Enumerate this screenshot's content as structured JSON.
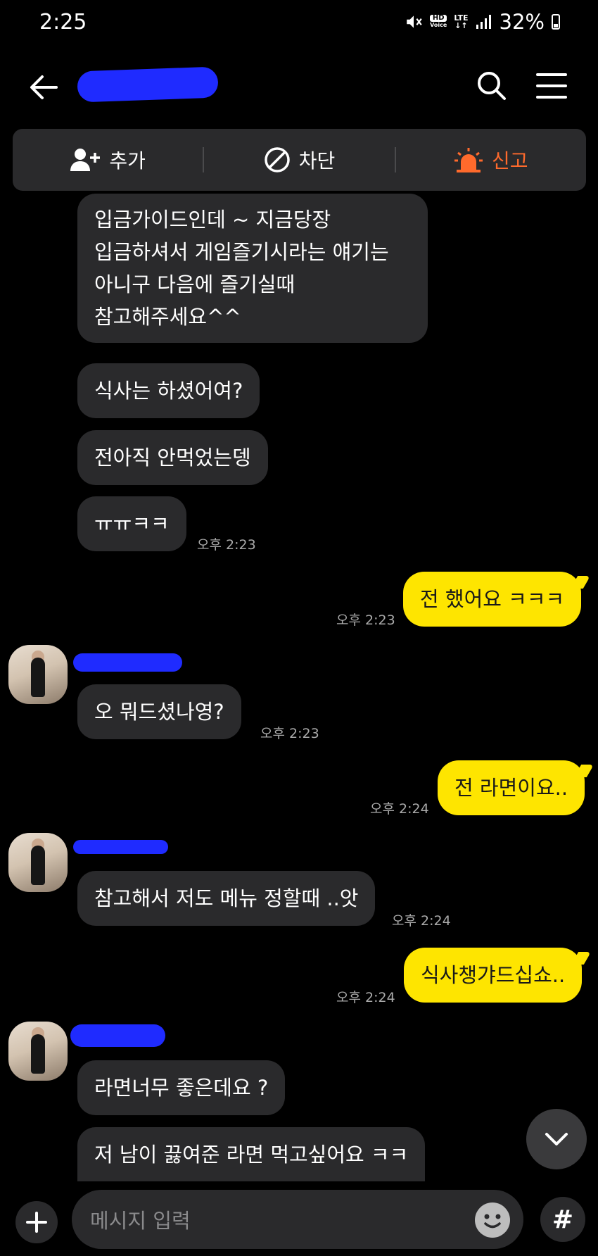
{
  "status_bar": {
    "time": "2:25",
    "hd_label": "HD",
    "voice_label": "Voice",
    "lte_label": "LTE",
    "battery": "32%"
  },
  "toolbar": {
    "add_label": "추가",
    "block_label": "차단",
    "report_label": "신고",
    "report_color": "#ff6a2c"
  },
  "colors": {
    "my_bubble": "#fee500",
    "their_bubble": "#2a2a2c",
    "redaction": "#1f2bff"
  },
  "messages": [
    {
      "sender": "other",
      "text_lines": [
        "입금가이드인데 ~ 지금당장",
        "입금하셔서 게임즐기시라는 얘기는",
        "아니구 다음에 즐기실때",
        "참고해주세요^^"
      ]
    },
    {
      "sender": "other",
      "text": "식사는 하셨어여?"
    },
    {
      "sender": "other",
      "text": "전아직 안먹었는뎅"
    },
    {
      "sender": "other",
      "text": "ㅠㅠㅋㅋ",
      "time": "오후 2:23"
    },
    {
      "sender": "me",
      "text": "전 했어요 ㅋㅋㅋ",
      "time": "오후 2:23"
    },
    {
      "sender": "other",
      "text": "오 뭐드셨나영?",
      "time": "오후 2:23"
    },
    {
      "sender": "me",
      "text": "전 라면이요..",
      "time": "오후 2:24"
    },
    {
      "sender": "other",
      "text": "참고해서 저도 메뉴 정할때 ..앗",
      "time": "오후 2:24"
    },
    {
      "sender": "me",
      "text": "식사챙갸드십쇼..",
      "time": "오후 2:24"
    },
    {
      "sender": "other",
      "text": "라면너무 좋은데요 ?"
    },
    {
      "sender": "other",
      "text": "저 남이 끓여준 라면 먹고싶어요 ㅋㅋ"
    }
  ],
  "input": {
    "placeholder": "메시지 입력"
  },
  "hash_label": "#"
}
